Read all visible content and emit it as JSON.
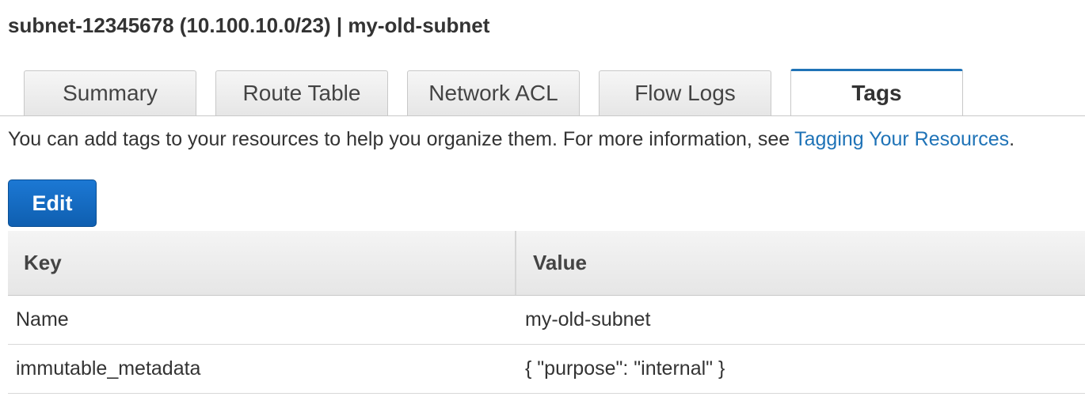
{
  "header": {
    "title": "subnet-12345678 (10.100.10.0/23) | my-old-subnet"
  },
  "tabs": [
    {
      "label": "Summary",
      "active": false
    },
    {
      "label": "Route Table",
      "active": false
    },
    {
      "label": "Network ACL",
      "active": false
    },
    {
      "label": "Flow Logs",
      "active": false
    },
    {
      "label": "Tags",
      "active": true
    }
  ],
  "info": {
    "text": "You can add tags to your resources to help you organize them. For more information, see",
    "link_text": "Tagging Your Resources",
    "suffix": "."
  },
  "actions": {
    "edit_label": "Edit"
  },
  "table": {
    "columns": [
      "Key",
      "Value"
    ],
    "rows": [
      {
        "key": "Name",
        "value": "my-old-subnet"
      },
      {
        "key": "immutable_metadata",
        "value": "{ \"purpose\": \"internal\" }"
      }
    ]
  },
  "colors": {
    "accent": "#1f73b7",
    "button": "#1466c0"
  }
}
